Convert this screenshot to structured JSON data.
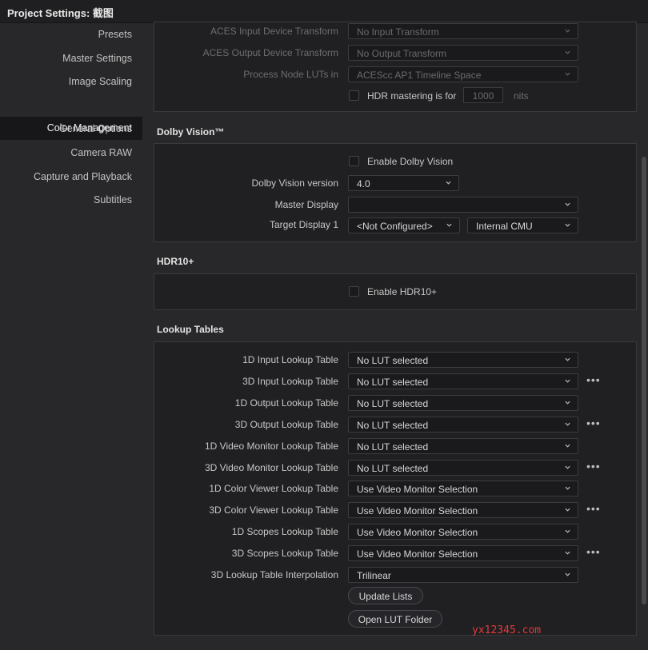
{
  "window": {
    "title": "Project Settings:  截图"
  },
  "sidebar": {
    "items": [
      {
        "label": "Presets"
      },
      {
        "label": "Master Settings"
      },
      {
        "label": "Image Scaling"
      },
      {
        "label": "Color Management",
        "active": true
      },
      {
        "label": "General Options"
      },
      {
        "label": "Camera RAW"
      },
      {
        "label": "Capture and Playback"
      },
      {
        "label": "Subtitles"
      }
    ]
  },
  "aces": {
    "input_label": "ACES Input Device Transform",
    "input_value": "No Input Transform",
    "output_label": "ACES Output Device Transform",
    "output_value": "No Output Transform",
    "luts_label": "Process Node LUTs in",
    "luts_value": "ACEScc AP1 Timeline Space",
    "hdr_label": "HDR mastering is for",
    "hdr_value": "1000",
    "hdr_unit": "nits"
  },
  "dolby": {
    "title": "Dolby Vision™",
    "enable_label": "Enable Dolby Vision",
    "version_label": "Dolby Vision version",
    "version_value": "4.0",
    "master_label": "Master Display",
    "master_value": "",
    "target_label": "Target Display 1",
    "target_value": "<Not Configured>",
    "cmu_value": "Internal CMU"
  },
  "hdr10": {
    "title": "HDR10+",
    "enable_label": "Enable HDR10+"
  },
  "lut": {
    "title": "Lookup Tables",
    "rows": [
      {
        "label": "1D Input Lookup Table",
        "value": "No LUT selected",
        "more": false
      },
      {
        "label": "3D Input Lookup Table",
        "value": "No LUT selected",
        "more": true
      },
      {
        "label": "1D Output Lookup Table",
        "value": "No LUT selected",
        "more": false
      },
      {
        "label": "3D Output Lookup Table",
        "value": "No LUT selected",
        "more": true
      },
      {
        "label": "1D Video Monitor Lookup Table",
        "value": "No LUT selected",
        "more": false
      },
      {
        "label": "3D Video Monitor Lookup Table",
        "value": "No LUT selected",
        "more": true
      },
      {
        "label": "1D Color Viewer Lookup Table",
        "value": "Use Video Monitor Selection",
        "more": false
      },
      {
        "label": "3D Color Viewer Lookup Table",
        "value": "Use Video Monitor Selection",
        "more": true
      },
      {
        "label": "1D Scopes Lookup Table",
        "value": "Use Video Monitor Selection",
        "more": false
      },
      {
        "label": "3D Scopes Lookup Table",
        "value": "Use Video Monitor Selection",
        "more": true
      },
      {
        "label": "3D Lookup Table Interpolation",
        "value": "Trilinear",
        "more": false
      }
    ],
    "more_label": "•••",
    "update_label": "Update Lists",
    "open_folder_label": "Open LUT Folder"
  },
  "watermark": "yx12345.com"
}
